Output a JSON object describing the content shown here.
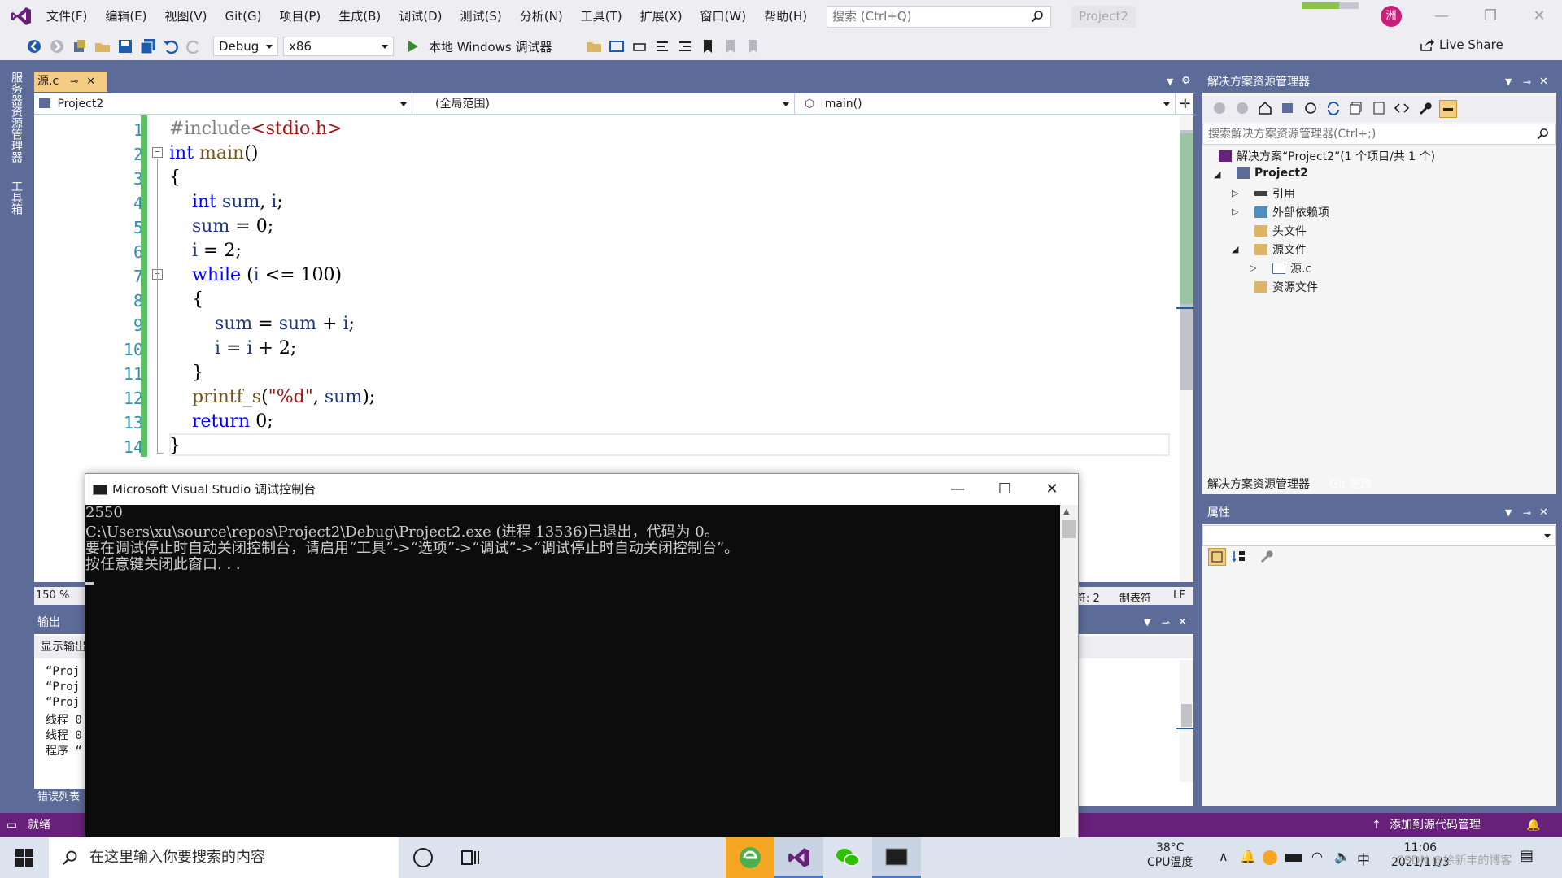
{
  "titlebar": {
    "menu": [
      "文件(F)",
      "编辑(E)",
      "视图(V)",
      "Git(G)",
      "项目(P)",
      "生成(B)",
      "调试(D)",
      "测试(S)",
      "分析(N)",
      "工具(T)",
      "扩展(X)",
      "窗口(W)",
      "帮助(H)"
    ],
    "search_placeholder": "搜索 (Ctrl+Q)",
    "project_name": "Project2",
    "avatar_initial": "洲",
    "minimize": "—",
    "maximize": "❐",
    "close": "✕"
  },
  "toolbar": {
    "config": "Debug",
    "platform": "x86",
    "run_label": "本地 Windows 调试器",
    "live_share": "Live Share"
  },
  "left_rail": {
    "tab1": "服务器资源管理器",
    "tab2": "工具箱"
  },
  "editor": {
    "tab_name": "源.c",
    "nav_project": "Project2",
    "nav_scope": "(全局范围)",
    "nav_function": "main()",
    "zoom": "150 %",
    "status_col": "符: 2",
    "status_tabs": "制表符",
    "status_eol": "LF",
    "line_numbers": [
      "1",
      "2",
      "3",
      "4",
      "5",
      "6",
      "7",
      "8",
      "9",
      "10",
      "11",
      "12",
      "13",
      "14"
    ]
  },
  "output": {
    "header": "输出",
    "show_output": "显示输出",
    "lines": [
      "“Proj",
      "“Proj",
      "“Proj",
      "线程 0",
      "线程 0",
      "程序 “"
    ],
    "error_list_tab": "错误列表"
  },
  "console": {
    "title": "Microsoft Visual Studio 调试控制台",
    "line1": "2550",
    "line2": "C:\\Users\\xu\\source\\repos\\Project2\\Debug\\Project2.exe (进程 13536)已退出，代码为 0。",
    "line3": "要在调试停止时自动关闭控制台，请启用“工具”->“选项”->“调试”->“调试停止时自动关闭控制台”。",
    "line4": "按任意键关闭此窗口. . ."
  },
  "solution_explorer": {
    "header": "解决方案资源管理器",
    "search_placeholder": "搜索解决方案资源管理器(Ctrl+;)",
    "items": [
      {
        "label": "解决方案“Project2”(1 个项目/共 1 个)"
      },
      {
        "label": "Project2"
      },
      {
        "label": "引用"
      },
      {
        "label": "外部依赖项"
      },
      {
        "label": "头文件"
      },
      {
        "label": "源文件"
      },
      {
        "label": "源.c"
      },
      {
        "label": "资源文件"
      }
    ],
    "tab_active": "解决方案资源管理器",
    "tab_git": "Git 更改"
  },
  "properties": {
    "header": "属性"
  },
  "statusbar": {
    "ready": "就绪",
    "source_control": "添加到源代码管理"
  },
  "taskbar": {
    "search_placeholder": "在这里输入你要搜索的内容",
    "temperature": "38°C",
    "temp_label": "CPU温度",
    "ime": "中",
    "time": "11:06",
    "date": "2021/11/3",
    "watermark": "CSDN @徐新丰的博客"
  },
  "colors": {
    "vs_purple": "#68217A",
    "frame_blue": "#5D6B99",
    "change_green": "#57C25F",
    "keyword_blue": "#0000FF"
  }
}
